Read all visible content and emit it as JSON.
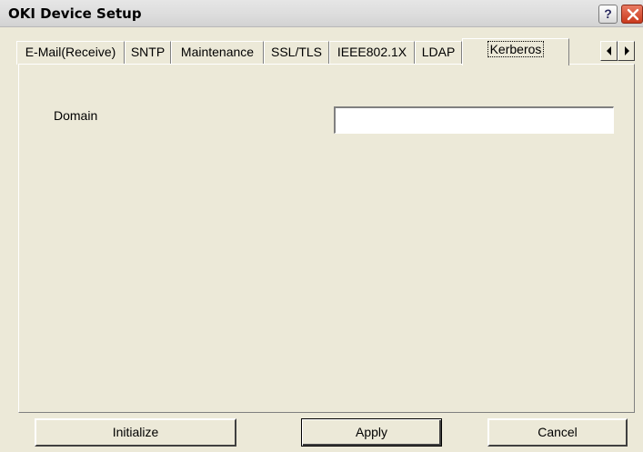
{
  "window": {
    "title": "OKI Device Setup",
    "help_glyph": "?"
  },
  "tabs": [
    {
      "label": "E-Mail(Receive)",
      "active": false
    },
    {
      "label": "SNTP",
      "active": false
    },
    {
      "label": "Maintenance",
      "active": false
    },
    {
      "label": "SSL/TLS",
      "active": false
    },
    {
      "label": "IEEE802.1X",
      "active": false
    },
    {
      "label": "LDAP",
      "active": false
    },
    {
      "label": "Kerberos",
      "active": true
    }
  ],
  "kerberos": {
    "domain_label": "Domain",
    "domain_value": ""
  },
  "buttons": {
    "initialize": "Initialize",
    "apply": "Apply",
    "cancel": "Cancel"
  },
  "icons": {
    "help": "help-icon",
    "close": "close-icon",
    "scroll_left": "arrow-left-icon",
    "scroll_right": "arrow-right-icon"
  }
}
